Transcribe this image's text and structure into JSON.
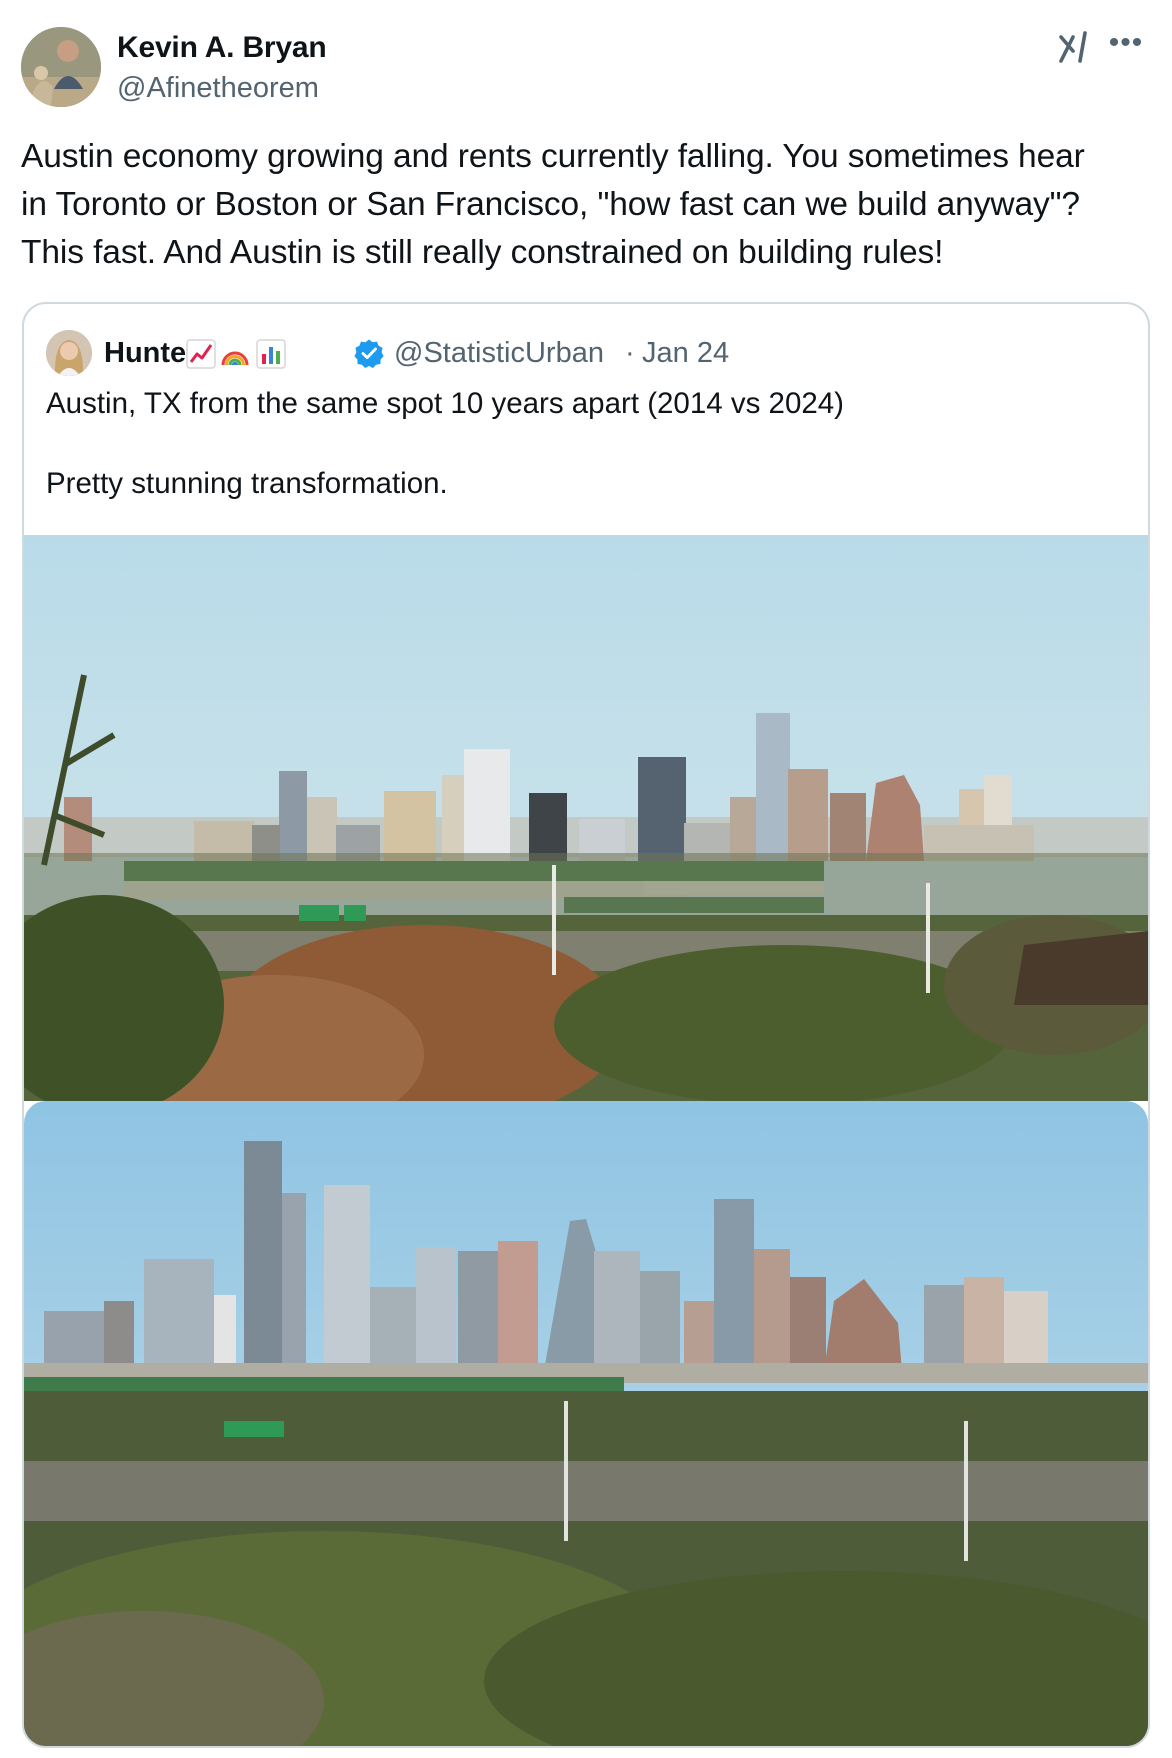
{
  "tweet": {
    "author": {
      "name": "Kevin A. Bryan",
      "handle": "@Afinetheorem",
      "avatar": "profile-photo"
    },
    "text_lines": [
      "Austin economy growing and rents currently falling. You sometimes hear",
      "in Toronto or Boston or San Francisco, \"how fast can we build anyway\"?",
      "This fast. And Austin is still really constrained on building rules!"
    ],
    "header_icons": [
      "grok-icon",
      "more-icon"
    ]
  },
  "quote": {
    "author": {
      "name": "Hunter",
      "name_emojis": [
        "chart-increasing-emoji",
        "rainbow-emoji",
        "bar-chart-emoji"
      ],
      "verified": true,
      "verified_color": "#1d9bf0",
      "handle": "@StatisticUrban",
      "separator": "·",
      "date": "Jan 24"
    },
    "text_line1": "Austin, TX from the same spot 10 years apart (2014 vs 2024)",
    "text_line2": "Pretty stunning transformation.",
    "photos": [
      {
        "description_icon": "austin-skyline-2014-photo"
      },
      {
        "description_icon": "austin-skyline-2024-photo"
      }
    ]
  },
  "colors": {
    "text": "#0f1419",
    "secondary_text": "#536471",
    "border": "#cfd9de",
    "accent": "#1d9bf0"
  }
}
